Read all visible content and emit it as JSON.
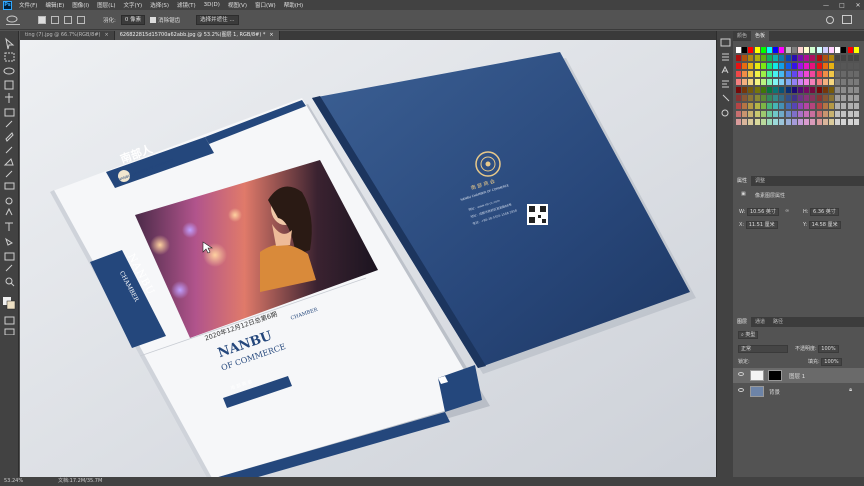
{
  "app": {
    "logo": "Ps"
  },
  "menu": [
    "文件(F)",
    "编辑(E)",
    "图像(I)",
    "图层(L)",
    "文字(Y)",
    "选择(S)",
    "滤镜(T)",
    "3D(D)",
    "视图(V)",
    "窗口(W)",
    "帮助(H)"
  ],
  "window_controls": [
    "—",
    "□",
    "✕"
  ],
  "options": {
    "feather_label": "羽化:",
    "feather_value": "0 像素",
    "antialias_label": "消除锯齿",
    "select_mask_label": "选择并遮住 ..."
  },
  "tabs": [
    {
      "label": "ting (7).jpg @ 66.7%(RGB/8#)",
      "close": "×"
    },
    {
      "label": "626822815d15700a62abb.jpg @ 53.2%(图层 1, RGB/8#) *",
      "close": "×"
    }
  ],
  "status": {
    "zoom": "53.24%",
    "doc": "文档:17.2M/35.7M"
  },
  "panels": {
    "swatch_tabs": [
      "颜色",
      "色板"
    ],
    "props_tabs": [
      "属性",
      "调整"
    ],
    "props_title": "像素图层属性",
    "w_label": "W:",
    "w_value": "10.56 英寸",
    "h_label": "H:",
    "h_value": "6.36 英寸",
    "x_label": "X:",
    "x_value": "11.51 厘米",
    "y_label": "Y:",
    "y_value": "14.58 厘米",
    "layers_tabs": [
      "图层",
      "通道",
      "路径"
    ],
    "kind_label": "类型",
    "blend_mode": "正常",
    "opacity_label": "不透明度:",
    "opacity_value": "100%",
    "lock_label": "锁定:",
    "fill_label": "填充:",
    "fill_value": "100%",
    "layers": [
      {
        "name": "图层 1",
        "selected": true
      },
      {
        "name": "背景",
        "selected": false
      }
    ]
  },
  "brochure": {
    "logo_text": "南部人",
    "logo_sub": "NANBU CHAMBER OF COMMERCE",
    "vertical_main": "NANBU",
    "vertical_sub": "CHAMBER",
    "date_line": "2020年12月12日总第6期",
    "nanbu": "NANBU",
    "chamber": "CHAMBER",
    "of_commerce": "OF COMMERCE",
    "cn_name_tag": "南 部 商 会",
    "back_cn_title": "南 部 商 会",
    "back_en_title": "NANBU CHAMBER OF COMMERCE",
    "back_line1": "网址：www.nb-cc.com",
    "back_line2": "地址：成都市高新区某某路88号",
    "back_line3": "电话：+86-28-5555-1568   2858"
  },
  "colors": {
    "brand_blue": "#24477c",
    "ps_accent": "#31a8ff"
  }
}
